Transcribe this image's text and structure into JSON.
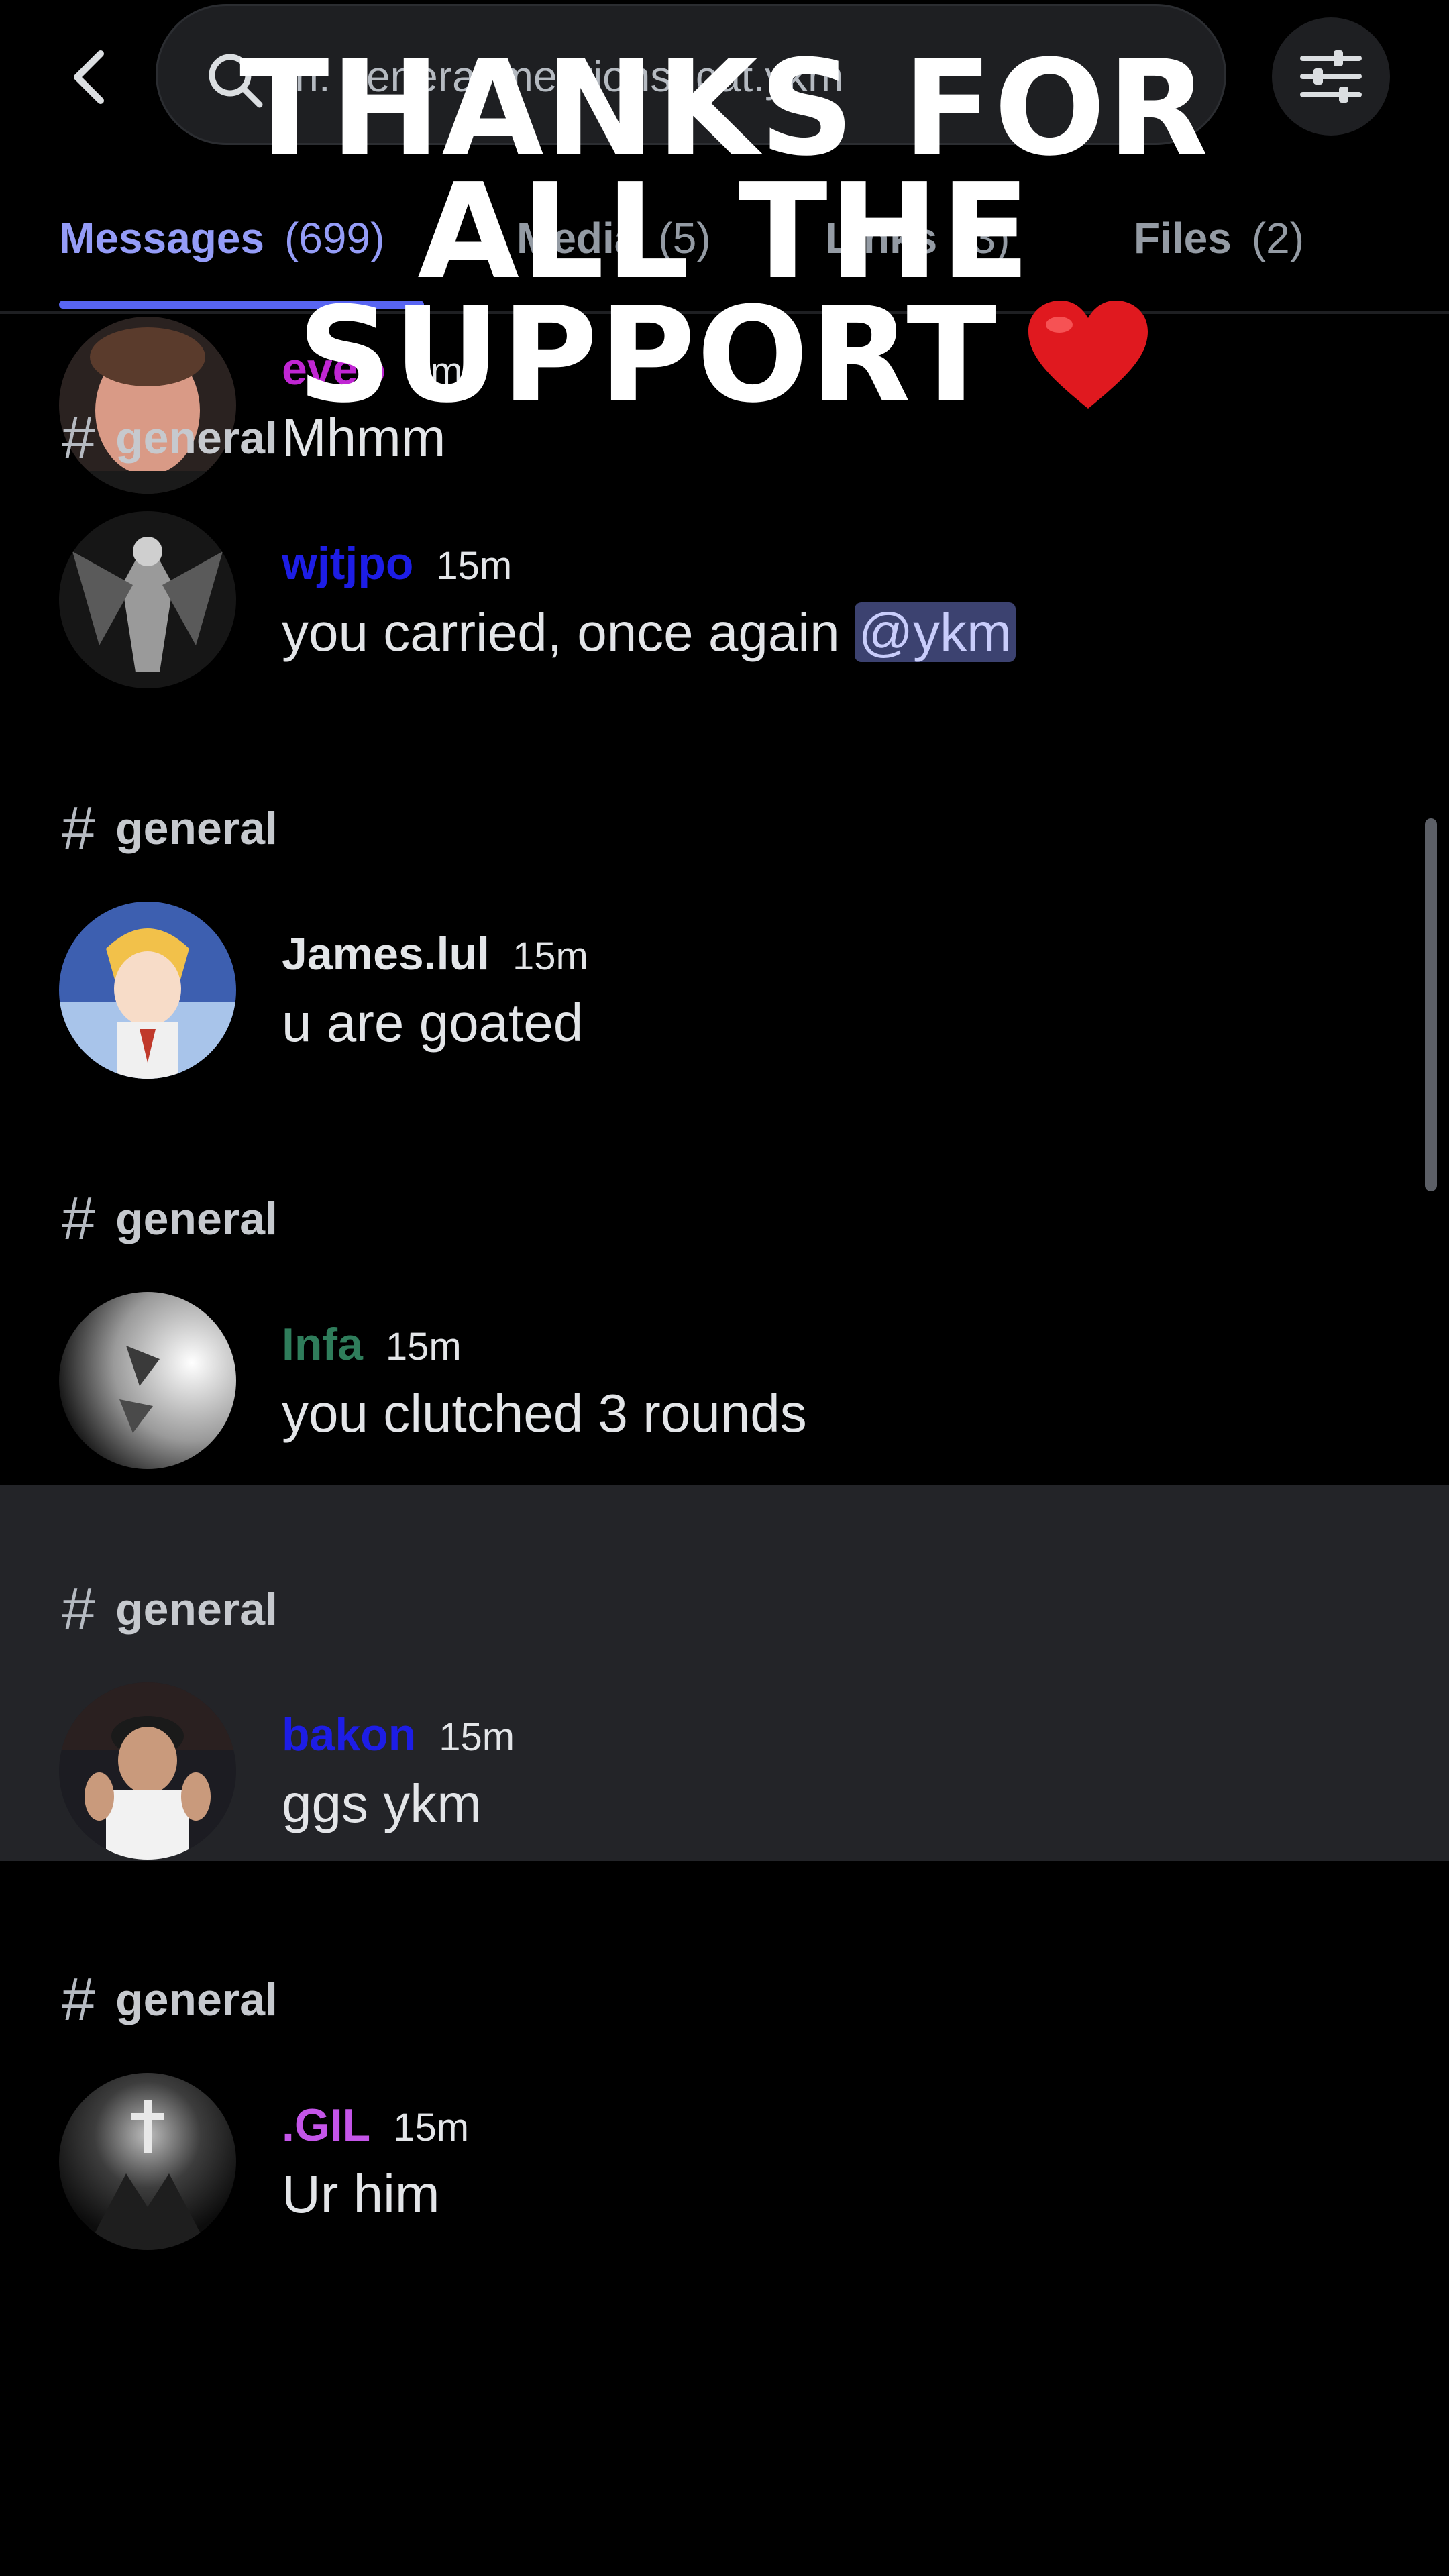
{
  "search": {
    "text": "in: general mentions: cat.ykm"
  },
  "tabs": [
    {
      "label": "Messages",
      "count": "(699)"
    },
    {
      "label": "Media",
      "count": "(5)"
    },
    {
      "label": "Links",
      "count": "(3)"
    },
    {
      "label": "Files",
      "count": "(2)"
    }
  ],
  "results": [
    {
      "channel": "general",
      "author": "eveo",
      "author_color": "#c026d3",
      "time": "4m",
      "message": "Mhmm"
    },
    {
      "channel": "general",
      "author": "wjtjpo",
      "author_color": "#1d1de6",
      "time": "15m",
      "message": "you carried, once again ",
      "mention": "@ykm"
    },
    {
      "channel": "general",
      "author": "James.lul",
      "author_color": "#e3e5e8",
      "time": "15m",
      "message": "u are goated"
    },
    {
      "channel": "general",
      "author": "Infa",
      "author_color": "#2f7d5b",
      "time": "15m",
      "message": "you clutched 3 rounds"
    },
    {
      "channel": "general",
      "author": "bakon",
      "author_color": "#1d1de6",
      "time": "15m",
      "message": "ggs ykm"
    },
    {
      "channel": "general",
      "author": ".GIL",
      "author_color": "#c455e8",
      "time": "15m",
      "message": "Ur him"
    }
  ],
  "overlay": {
    "line1": "THANKS FOR",
    "line2": "ALL THE",
    "line3": "SUPPORT"
  },
  "colors": {
    "accent": "#5865f2",
    "background": "#000000",
    "highlight": "#232428"
  }
}
